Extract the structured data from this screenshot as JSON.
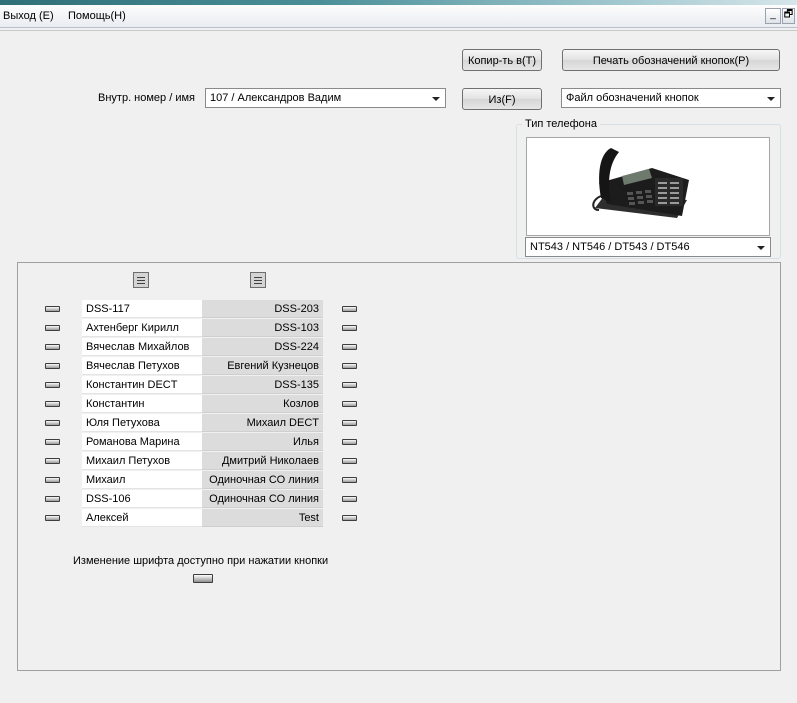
{
  "menu": {
    "items": [
      {
        "label": "Выход (E)"
      },
      {
        "label": "Помощь(H)"
      }
    ],
    "minimize_glyph": "_",
    "restore_glyph": "🗗"
  },
  "toolbar": {
    "copy_to_label": "Копир-ть в(T)",
    "from_label": "Из(F)",
    "print_labels_label": "Печать обозначений кнопок(P)"
  },
  "extension": {
    "label": "Внутр. номер / имя",
    "selected": "107 / Александров Вадим"
  },
  "label_file": {
    "selected": "Файл обозначений кнопок"
  },
  "phone_type": {
    "title": "Тип телефона",
    "selected": "NT543 / NT546 / DT543 / DT546",
    "image_icon": "phone-image"
  },
  "buttons_table": {
    "rows": [
      {
        "left": "DSS-117",
        "right": "DSS-203"
      },
      {
        "left": "Ахтенберг Кирилл",
        "right": "DSS-103"
      },
      {
        "left": "Вячеслав Михайлов",
        "right": "DSS-224"
      },
      {
        "left": "Вячеслав Петухов",
        "right": "Евгений Кузнецов"
      },
      {
        "left": "Константин DECT",
        "right": "DSS-135"
      },
      {
        "left": "Константин",
        "right": "Козлов"
      },
      {
        "left": "Юля Петухова",
        "right": "Михаил DECT"
      },
      {
        "left": "Романова Марина",
        "right": "Илья"
      },
      {
        "left": "Михаил Петухов",
        "right": "Дмитрий Николаев"
      },
      {
        "left": "Михаил",
        "right": "Одиночная СО линия"
      },
      {
        "left": "DSS-106",
        "right": "Одиночная СО линия"
      },
      {
        "left": "Алексей",
        "right": "Test"
      }
    ]
  },
  "font_note": "Изменение шрифта доступно при нажатии кнопки"
}
